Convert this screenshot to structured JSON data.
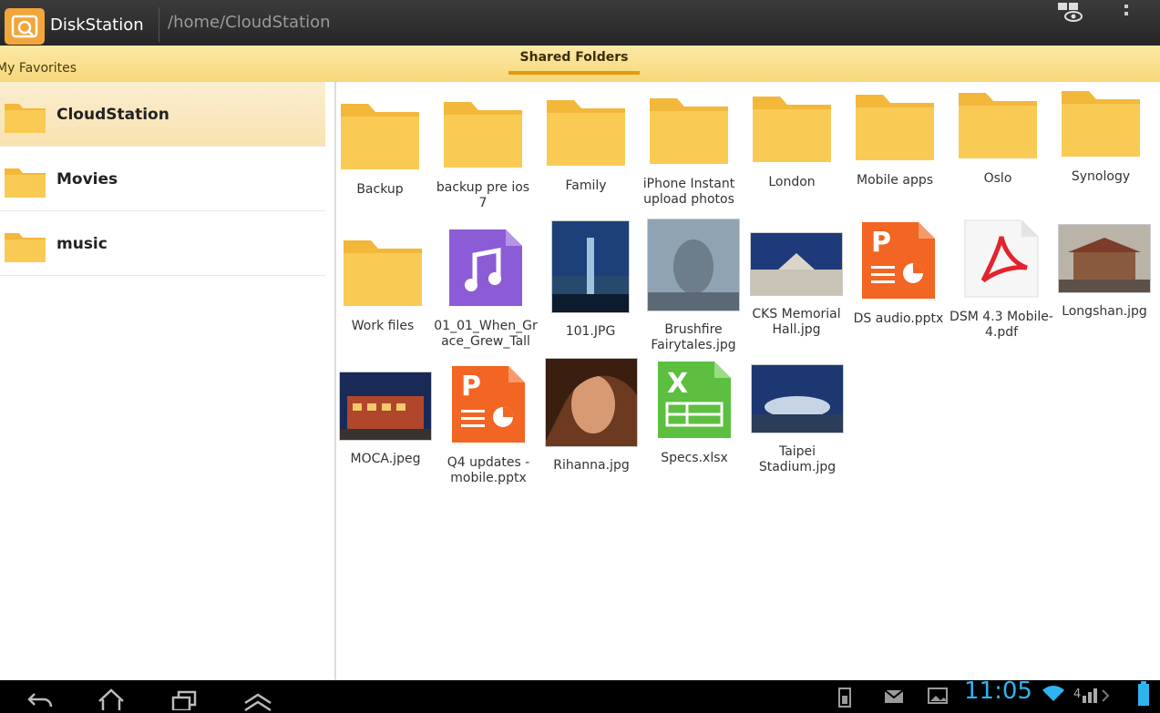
{
  "app": {
    "title": "DiskStation",
    "path": "/home/CloudStation"
  },
  "tabs": {
    "favorites": "My Favorites",
    "shared": "Shared Folders"
  },
  "favorites": [
    {
      "label": "CloudStation",
      "selected": true
    },
    {
      "label": "Movies",
      "selected": false
    },
    {
      "label": "music",
      "selected": false
    }
  ],
  "files": [
    {
      "name": "Backup",
      "type": "folder"
    },
    {
      "name": "backup pre ios 7",
      "type": "folder"
    },
    {
      "name": "Family",
      "type": "folder"
    },
    {
      "name": "iPhone Instant upload photos",
      "type": "folder"
    },
    {
      "name": "London",
      "type": "folder"
    },
    {
      "name": "Mobile apps",
      "type": "folder"
    },
    {
      "name": "Oslo",
      "type": "folder"
    },
    {
      "name": "Synology",
      "type": "folder"
    },
    {
      "name": "Work files",
      "type": "folder"
    },
    {
      "name": "01_01_When_Grace_Grew_Tall",
      "type": "music"
    },
    {
      "name": "101.JPG",
      "type": "photo"
    },
    {
      "name": "Brushfire Fairytales.jpg",
      "type": "photo"
    },
    {
      "name": "CKS Memorial Hall.jpg",
      "type": "photo"
    },
    {
      "name": "DS audio.pptx",
      "type": "pptx"
    },
    {
      "name": "DSM 4.3 Mobile-4.pdf",
      "type": "pdf"
    },
    {
      "name": "Longshan.jpg",
      "type": "photo"
    },
    {
      "name": "MOCA.jpeg",
      "type": "photo"
    },
    {
      "name": "Q4 updates - mobile.pptx",
      "type": "pptx"
    },
    {
      "name": "Rihanna.jpg",
      "type": "photo"
    },
    {
      "name": "Specs.xlsx",
      "type": "xlsx"
    },
    {
      "name": "Taipei Stadium.jpg",
      "type": "photo"
    }
  ],
  "status": {
    "time": "11:05"
  },
  "colors": {
    "accent": "#f2a63a",
    "folder": "#f7c84a",
    "clock": "#2fb4f0",
    "pptx": "#f26522",
    "xlsx": "#5cbf3f",
    "music": "#8c5cd6",
    "pdf": "#e3232c"
  }
}
